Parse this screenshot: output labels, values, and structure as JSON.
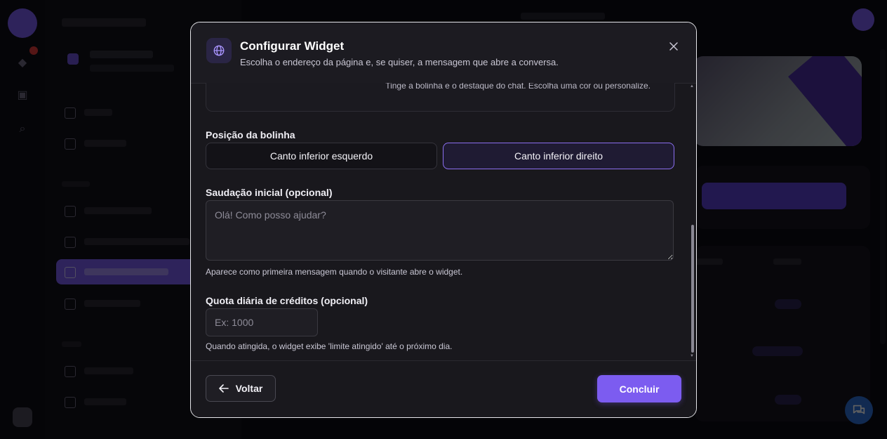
{
  "modal": {
    "title": "Configurar Widget",
    "subtitle": "Escolha o endereço da página e, se quiser, a mensagem que abre a conversa.",
    "color_hint": "Tinge a bolinha e o destaque do chat. Escolha uma cor ou personalize.",
    "position": {
      "label": "Posição da bolinha",
      "options": [
        "Canto inferior esquerdo",
        "Canto inferior direito"
      ],
      "selected": "Canto inferior direito"
    },
    "greeting": {
      "label": "Saudação inicial (opcional)",
      "placeholder": "Olá! Como posso ajudar?",
      "value": "",
      "help": "Aparece como primeira mensagem quando o visitante abre o widget."
    },
    "quota": {
      "label": "Quota diária de créditos (opcional)",
      "placeholder": "Ex: 1000",
      "value": "",
      "help": "Quando atingida, o widget exibe 'limite atingido' até o próximo dia."
    },
    "footer": {
      "back_label": "Voltar",
      "done_label": "Concluir"
    }
  },
  "colors": {
    "accent": "#7c5cf0",
    "modal_bg": "#19181d",
    "selected_border": "#8b6ff0"
  },
  "icons": {
    "header": "globe-icon",
    "close": "close-icon",
    "back": "arrow-left-icon",
    "chat": "chat-bubbles-icon"
  }
}
